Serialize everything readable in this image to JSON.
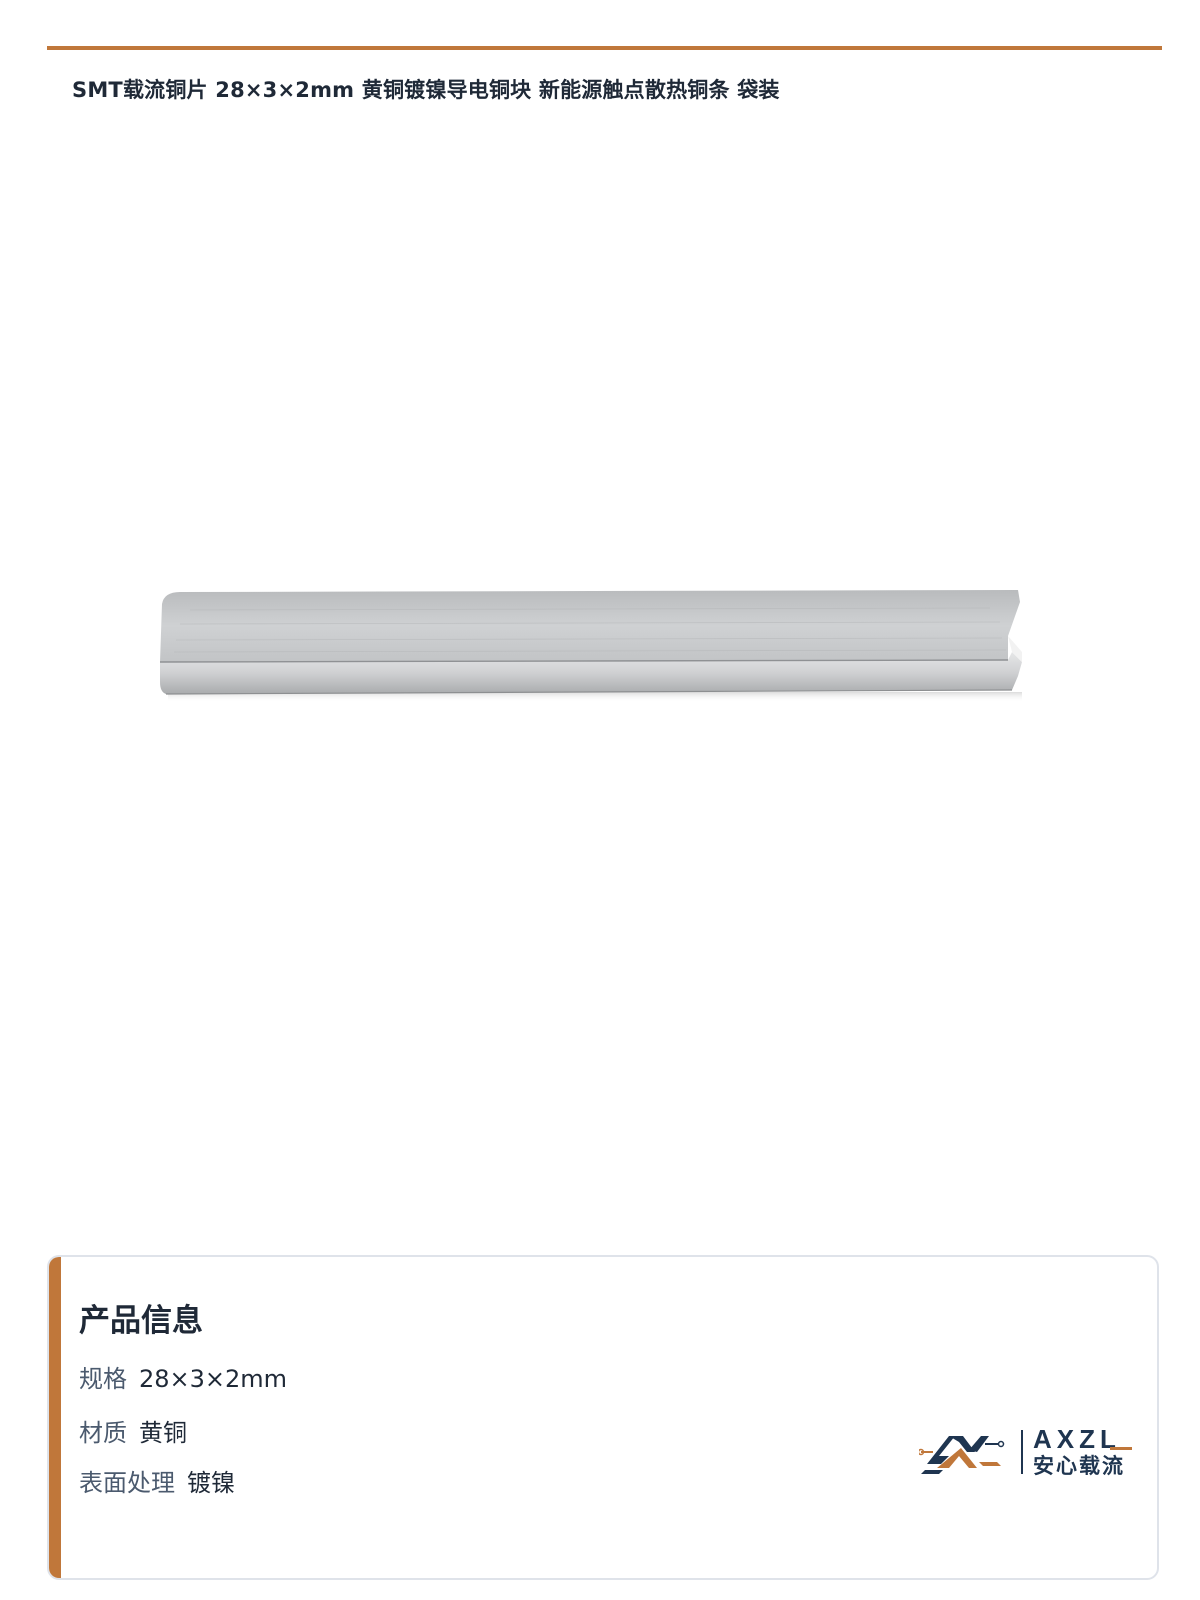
{
  "title": "SMT载流铜片 28×3×2mm 黄铜镀镍导电铜块 新能源触点散热铜条 袋装",
  "colors": {
    "accent": "#c0773a",
    "navy": "#1f3550",
    "text": "#1f2937",
    "label": "#4b5a6e",
    "card_border": "#dfe3ea"
  },
  "product_image": {
    "icon": "nickel-plated-copper-bar"
  },
  "info_card": {
    "heading": "产品信息",
    "specs": [
      {
        "label": "规格",
        "value": "28×3×2mm"
      },
      {
        "label": "材质",
        "value": "黄铜"
      },
      {
        "label": "表面处理",
        "value": "镀镍"
      }
    ]
  },
  "brand": {
    "wordmark": "AXZL",
    "name_cn": "安心载流",
    "icon": "axzl-logo-mark"
  }
}
